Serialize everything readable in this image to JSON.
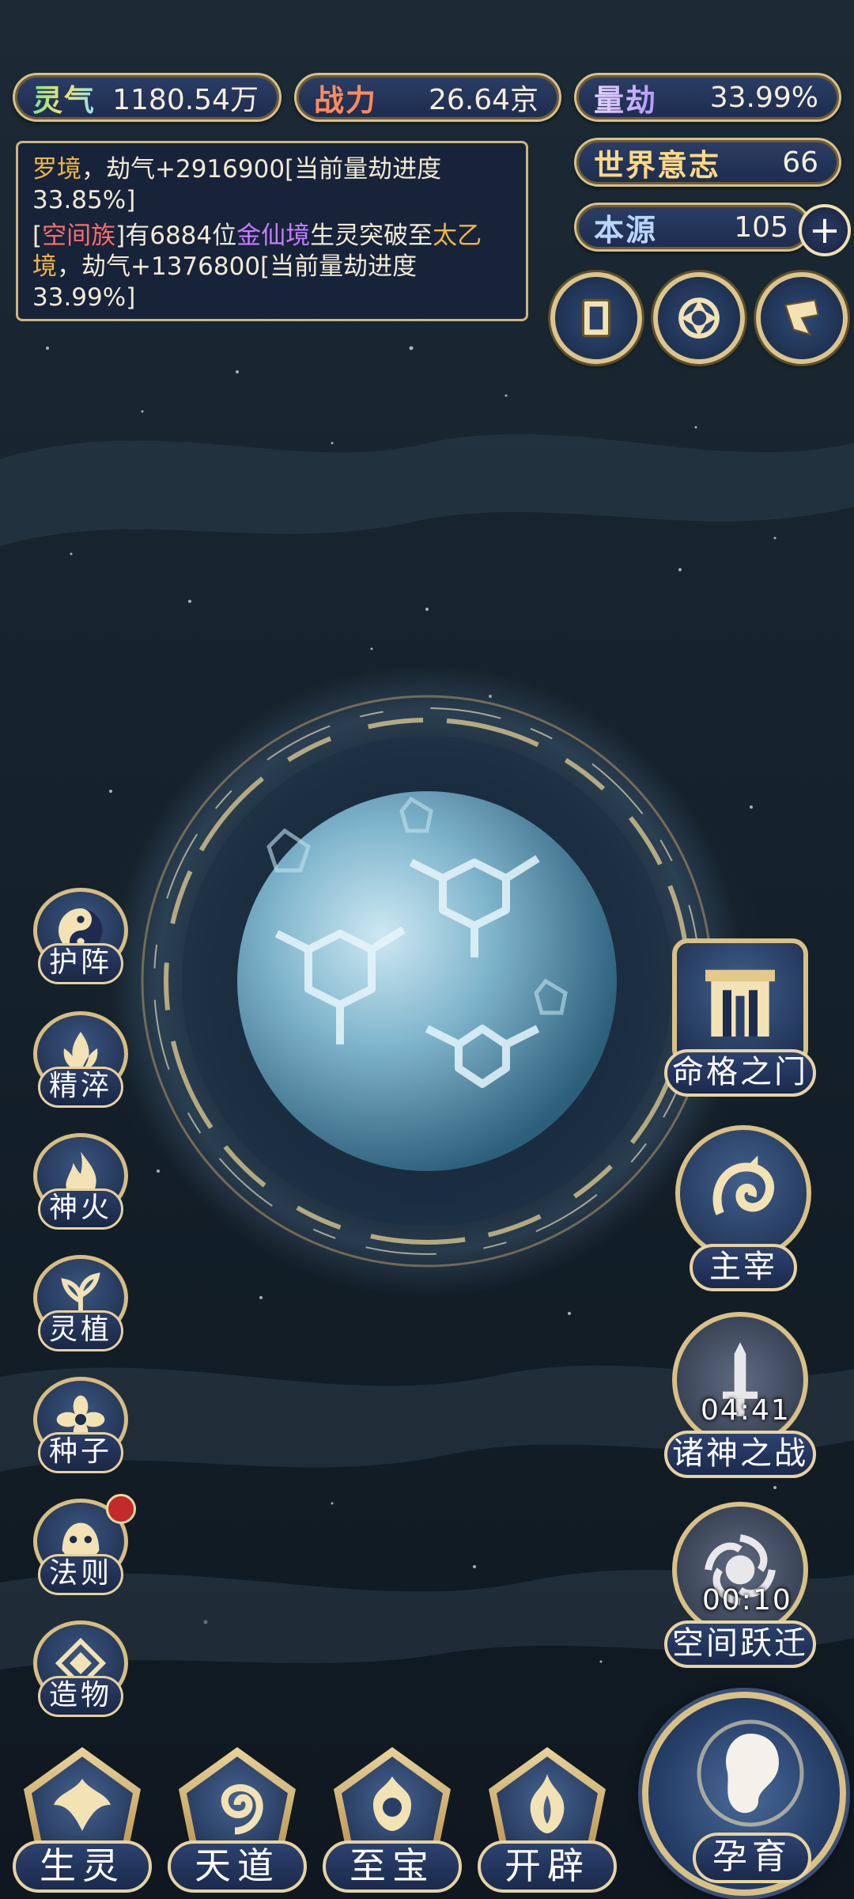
{
  "stats": {
    "lingqi": {
      "label": "灵气",
      "value": "1180.54万"
    },
    "zhanli": {
      "label": "战力",
      "value": "26.64京"
    },
    "liangjie": {
      "label": "量劫",
      "value": "33.99%"
    },
    "world_will": {
      "label": "世界意志",
      "value": "66"
    },
    "benyuan": {
      "label": "本源",
      "value": "105",
      "add_icon": "plus-icon"
    }
  },
  "log": {
    "entries": [
      {
        "part1": "罗境",
        "part2": "，劫气+2916900[当前量劫进度33.85%]"
      },
      {
        "bracket_open": "[",
        "race": "空间族",
        "bracket_close": "]",
        "mid1": "有6884位",
        "realm1": "金仙境",
        "mid2": "生灵突破至",
        "realm2": "太乙境",
        "tail": "，劫气+1376800[当前量劫进度33.99%]"
      }
    ]
  },
  "tools": [
    {
      "icon": "card-icon"
    },
    {
      "icon": "vortex-icon"
    },
    {
      "icon": "flag-icon"
    }
  ],
  "left_menu": [
    {
      "label": "护阵",
      "icon": "yin-yang-icon"
    },
    {
      "label": "精淬",
      "icon": "lotus-flame-icon"
    },
    {
      "label": "神火",
      "icon": "fire-icon"
    },
    {
      "label": "灵植",
      "icon": "plant-icon"
    },
    {
      "label": "种子",
      "icon": "seed-flower-icon"
    },
    {
      "label": "法则",
      "icon": "beast-icon",
      "badge": true
    },
    {
      "label": "造物",
      "icon": "rune-icon"
    }
  ],
  "right_menu": [
    {
      "label": "命格之门",
      "icon": "gate-icon"
    },
    {
      "label": "主宰",
      "icon": "dragon-icon"
    },
    {
      "label": "诸神之战",
      "icon": "sword-icon",
      "timer": "04:41"
    },
    {
      "label": "空间跃迁",
      "icon": "portal-icon",
      "timer": "00:10"
    }
  ],
  "bottom_nav": [
    {
      "label": "生灵",
      "icon": "phoenix-icon"
    },
    {
      "label": "天道",
      "icon": "swirl-icon"
    },
    {
      "label": "至宝",
      "icon": "treasure-icon"
    },
    {
      "label": "开辟",
      "icon": "flame-crest-icon"
    }
  ],
  "main_action": {
    "label": "孕育",
    "icon": "embryo-icon"
  },
  "colors": {
    "gold": "#d8c089",
    "panel": "#1d2c4e",
    "highlight_yellow": "#f2b540",
    "highlight_purple": "#c77dff",
    "highlight_red": "#ff6b6b"
  }
}
